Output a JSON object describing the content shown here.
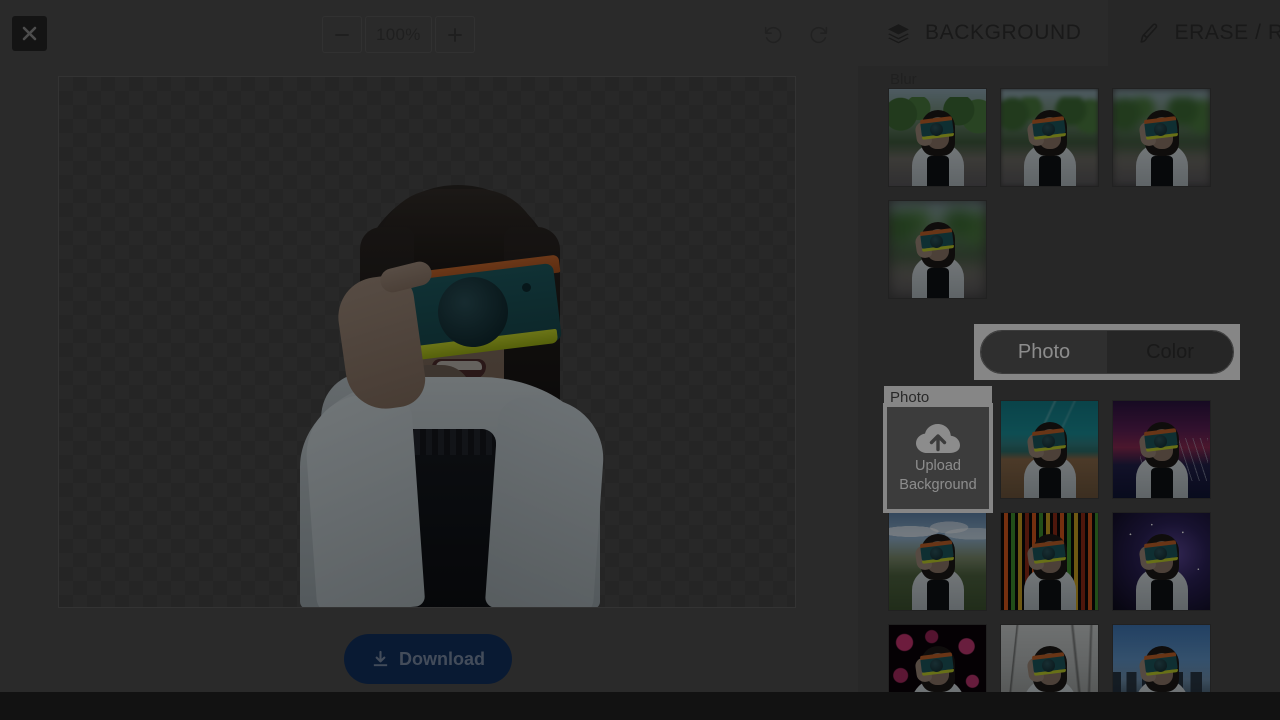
{
  "app": {
    "dim_overlay": true,
    "bottom_bar_color": "#121212",
    "editor_bg": "#4d4d4d",
    "panel_bg": "#474747"
  },
  "toolbar": {
    "close_icon": "close-icon",
    "zoom_out_label": "−",
    "zoom_level": "100%",
    "zoom_in_label": "+",
    "undo_icon": "undo-icon",
    "redo_icon": "redo-icon"
  },
  "canvas": {
    "transparency": "checkerboard",
    "subject": "woman-holding-camera"
  },
  "download": {
    "label": "Download",
    "icon": "download-icon",
    "color": "#12305e"
  },
  "panel": {
    "tabs": [
      {
        "label": "BACKGROUND",
        "icon": "layers-icon",
        "active": true
      },
      {
        "label": "ERASE / REST",
        "icon": "brush-icon",
        "active": false
      }
    ],
    "blur": {
      "label": "Blur",
      "items": [
        {
          "name": "blur-none",
          "level": 0
        },
        {
          "name": "blur-light",
          "level": 1
        },
        {
          "name": "blur-medium",
          "level": 2
        },
        {
          "name": "blur-heavy",
          "level": 3
        }
      ]
    },
    "mode_toggle": {
      "options": [
        {
          "label": "Photo",
          "active": true
        },
        {
          "label": "Color",
          "active": false
        }
      ]
    },
    "photo": {
      "label": "Photo",
      "upload": {
        "line1": "Upload",
        "line2": "Background",
        "icon": "cloud-upload-icon"
      },
      "items": [
        {
          "name": "background-beach",
          "style": "bg-beach"
        },
        {
          "name": "background-city-sunset",
          "style": "bg-citysunset"
        },
        {
          "name": "background-field",
          "style": "bg-field"
        },
        {
          "name": "background-stripes",
          "style": "bg-stripes"
        },
        {
          "name": "background-galaxy",
          "style": "bg-galaxy"
        },
        {
          "name": "background-bokeh",
          "style": "bg-bokeh"
        },
        {
          "name": "background-winter",
          "style": "bg-winter"
        },
        {
          "name": "background-city-blue",
          "style": "bg-cityblue"
        }
      ]
    }
  }
}
